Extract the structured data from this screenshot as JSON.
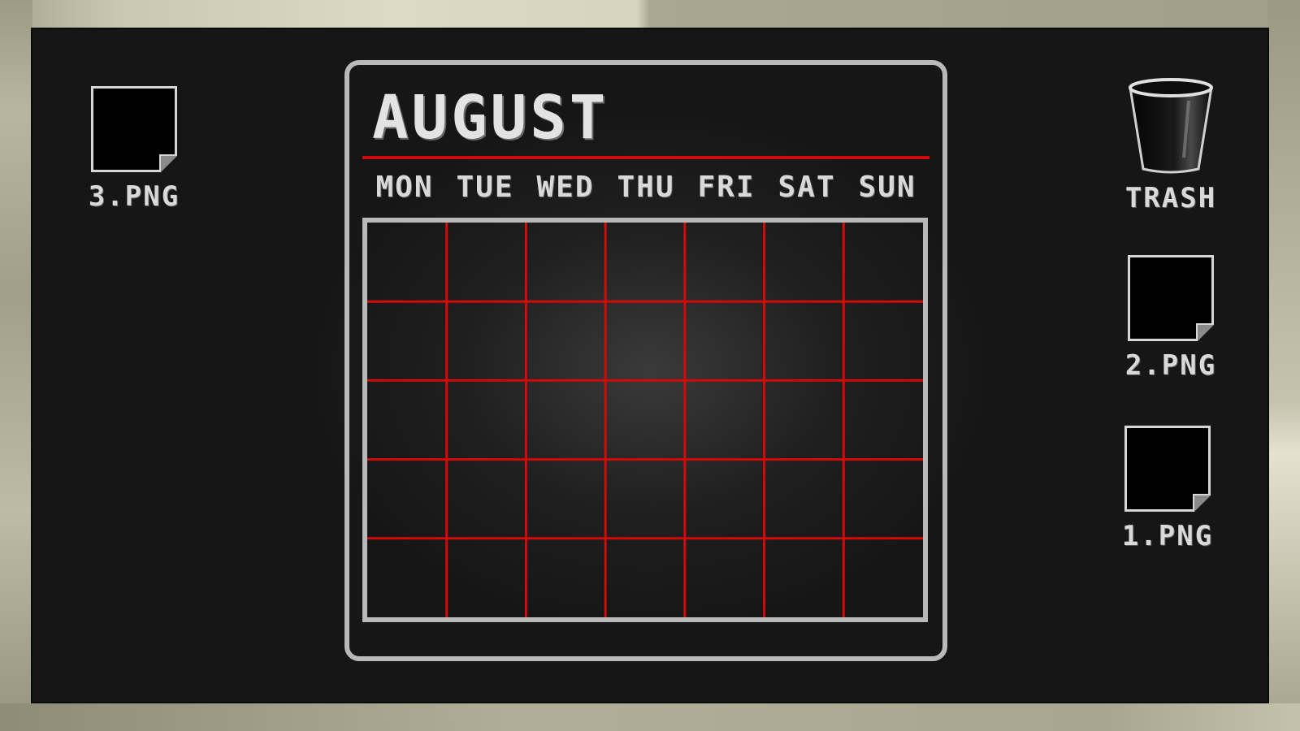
{
  "desktop": {
    "icons": [
      {
        "label": "3.PNG",
        "type": "image-file"
      },
      {
        "label": "TRASH",
        "type": "trash-bin"
      },
      {
        "label": "2.PNG",
        "type": "image-file"
      },
      {
        "label": "1.PNG",
        "type": "image-file"
      }
    ]
  },
  "calendar": {
    "month": "AUGUST",
    "weekdays": [
      "MON",
      "TUE",
      "WED",
      "THU",
      "FRI",
      "SAT",
      "SUN"
    ],
    "rows": 5,
    "columns": 7,
    "grid_line_color": "#d10a0a",
    "border_color": "#b9b9b9"
  },
  "colors": {
    "background": "#151515",
    "frame": "#c9c7b1",
    "text": "#d9d9d9",
    "accent": "#d10a0a"
  }
}
